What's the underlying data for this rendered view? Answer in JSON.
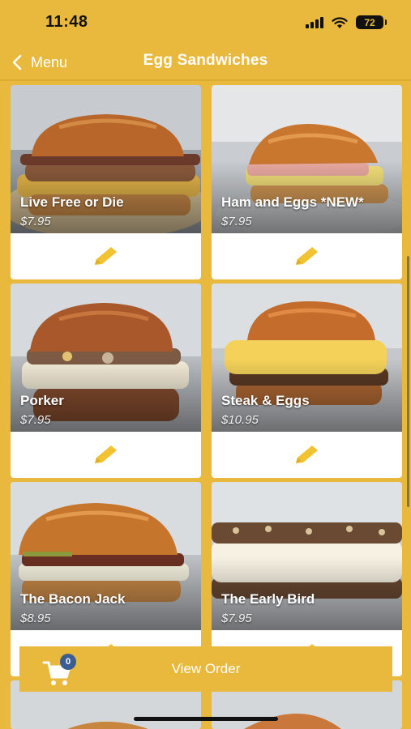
{
  "status": {
    "time": "11:48",
    "battery": "72"
  },
  "nav": {
    "back_label": "Menu",
    "title": "Egg Sandwiches"
  },
  "items": [
    {
      "name": "Live Free or Die",
      "price": "$7.95"
    },
    {
      "name": "Ham and Eggs *NEW*",
      "price": "$7.95"
    },
    {
      "name": "Porker",
      "price": "$7.95"
    },
    {
      "name": "Steak & Eggs",
      "price": "$10.95"
    },
    {
      "name": "The Bacon Jack",
      "price": "$8.95"
    },
    {
      "name": "The Early Bird",
      "price": "$7.95"
    }
  ],
  "order_bar": {
    "label": "View Order",
    "cart_count": "0"
  },
  "icons": {
    "back": "chevron-left-icon",
    "edit": "pencil-icon",
    "cart": "shopping-cart-icon"
  },
  "colors": {
    "brand_yellow": "#E8B93C",
    "icon_yellow": "#F1C232",
    "badge_blue": "#3B5D91"
  }
}
